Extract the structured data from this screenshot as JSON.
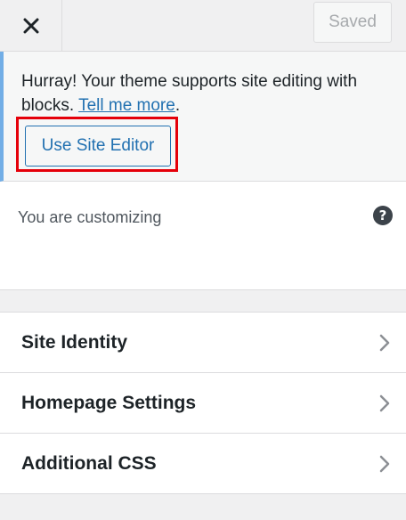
{
  "header": {
    "saved_label": "Saved"
  },
  "notice": {
    "message": "Hurray! Your theme supports site editing with blocks.",
    "link_text": "Tell me more",
    "trailing": ".",
    "button_label": "Use Site Editor",
    "highlight_color": "#e5000a"
  },
  "customizing": {
    "label": "You are customizing",
    "help_icon": "?"
  },
  "sections": [
    {
      "label": "Site Identity"
    },
    {
      "label": "Homepage Settings"
    },
    {
      "label": "Additional CSS"
    }
  ],
  "colors": {
    "accent": "#2271b1",
    "notice_border": "#72aee6"
  }
}
